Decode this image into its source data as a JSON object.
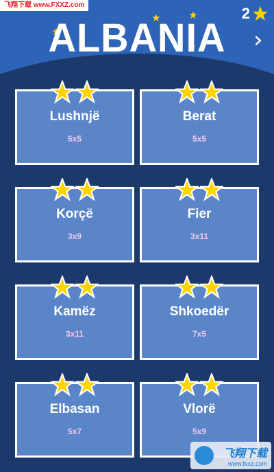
{
  "header": {
    "title": "ALBANIA",
    "stars_count": "2",
    "next_icon": "chevron-right-icon",
    "colors": {
      "header_bg": "#2e64b7",
      "page_bg": "#1b3a6b",
      "star": "#ffd400"
    }
  },
  "watermark": {
    "top_text": "飞翔下载 www.FXXZ.com",
    "bottom_title": "飞翔下载",
    "bottom_url": "www.fxxz.com"
  },
  "levels": [
    {
      "name": "Lushnjë",
      "size": "5x5",
      "stars": 2
    },
    {
      "name": "Berat",
      "size": "5x5",
      "stars": 2
    },
    {
      "name": "Korçë",
      "size": "3x9",
      "stars": 2
    },
    {
      "name": "Fier",
      "size": "3x11",
      "stars": 2
    },
    {
      "name": "Kamëz",
      "size": "3x11",
      "stars": 2
    },
    {
      "name": "Shkoedër",
      "size": "7x5",
      "stars": 2
    },
    {
      "name": "Elbasan",
      "size": "5x7",
      "stars": 2
    },
    {
      "name": "Vlorë",
      "size": "5x9",
      "stars": 2
    }
  ]
}
